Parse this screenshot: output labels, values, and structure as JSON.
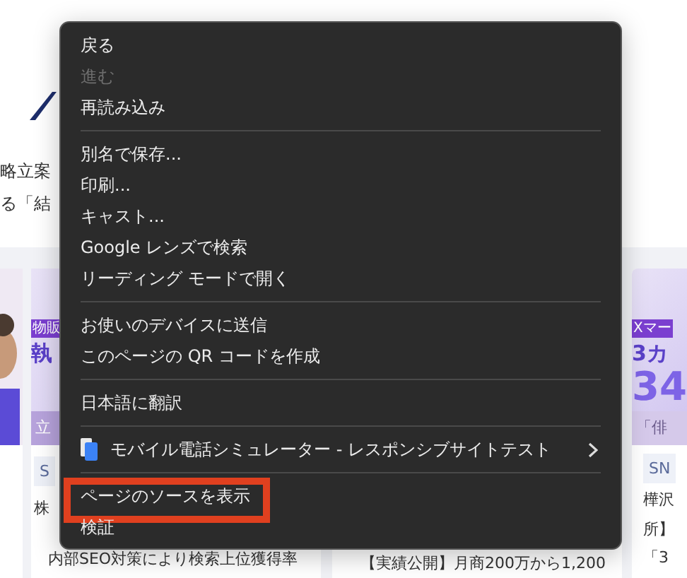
{
  "page": {
    "lines": [
      "略立案",
      "る「結"
    ]
  },
  "cards": [
    {
      "kind": "picture"
    },
    {
      "kind": "article",
      "tag": "物販",
      "headline": "執",
      "band": "立",
      "chip": "S",
      "author": "株",
      "title": "内部SEO対策により検索上位獲得率"
    },
    {
      "kind": "article",
      "title": "【実績公開】月商200万から1,200"
    },
    {
      "kind": "article",
      "tag": "Xマー",
      "headline": "3カ",
      "big": "34",
      "band": "「俳",
      "chip": "SN",
      "author": "樺沢",
      "author2": "所】",
      "title": "「3"
    }
  ],
  "menu": {
    "items": [
      {
        "kind": "item",
        "label": "戻る",
        "disabled": false
      },
      {
        "kind": "item",
        "label": "進む",
        "disabled": true
      },
      {
        "kind": "item",
        "label": "再読み込み",
        "disabled": false
      },
      {
        "kind": "separator"
      },
      {
        "kind": "item",
        "label": "別名で保存...",
        "disabled": false
      },
      {
        "kind": "item",
        "label": "印刷...",
        "disabled": false
      },
      {
        "kind": "item",
        "label": "キャスト...",
        "disabled": false
      },
      {
        "kind": "item",
        "label": "Google レンズで検索",
        "disabled": false
      },
      {
        "kind": "item",
        "label": "リーディング モードで開く",
        "disabled": false
      },
      {
        "kind": "separator"
      },
      {
        "kind": "item",
        "label": "お使いのデバイスに送信",
        "disabled": false
      },
      {
        "kind": "item",
        "label": "このページの QR コードを作成",
        "disabled": false
      },
      {
        "kind": "separator"
      },
      {
        "kind": "item",
        "label": "日本語に翻訳",
        "disabled": false
      },
      {
        "kind": "separator"
      },
      {
        "kind": "submenu",
        "label": "モバイル電話シミュレーター - レスポンシブサイトテスト",
        "disabled": false
      },
      {
        "kind": "separator"
      },
      {
        "kind": "item",
        "label": "ページのソースを表示",
        "disabled": false,
        "highlighted": true
      },
      {
        "kind": "item",
        "label": "検証",
        "disabled": false
      }
    ]
  }
}
